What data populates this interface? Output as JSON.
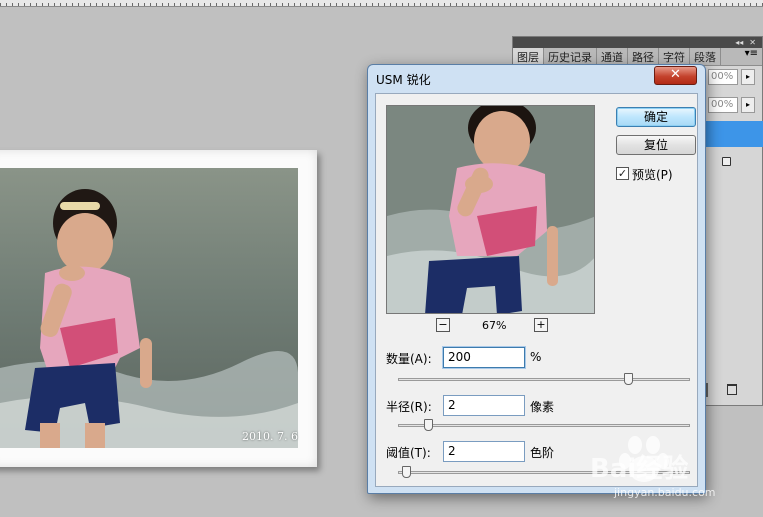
{
  "canvas": {
    "photo_date": "2010. 7. 6"
  },
  "panel": {
    "tabs": [
      "图层",
      "历史记录",
      "通道",
      "路径",
      "字符",
      "段落"
    ],
    "opacity_1": "00%",
    "opacity_2": "00%",
    "menu": "▾≡"
  },
  "dialog": {
    "title": "USM 锐化",
    "close": "✕",
    "ok_label": "确定",
    "reset_label": "复位",
    "preview_label": "预览(P)",
    "preview_checked": true,
    "zoom_out": "−",
    "zoom_in": "+",
    "zoom_value": "67%",
    "amount": {
      "label": "数量(A):",
      "value": "200",
      "unit": "%",
      "level": 0.8
    },
    "radius": {
      "label": "半径(R):",
      "value": "2",
      "unit": "像素",
      "level": 0.09
    },
    "threshold": {
      "label": "阈值(T):",
      "value": "2",
      "unit": "色阶",
      "level": 0.01
    }
  },
  "watermark": {
    "brand": "Bai经验",
    "url": "jingyan.baidu.com"
  },
  "colors": {
    "dialog_frame": "#cfe1f3",
    "close_red": "#c4432d",
    "selection_blue": "#3d95e8"
  }
}
